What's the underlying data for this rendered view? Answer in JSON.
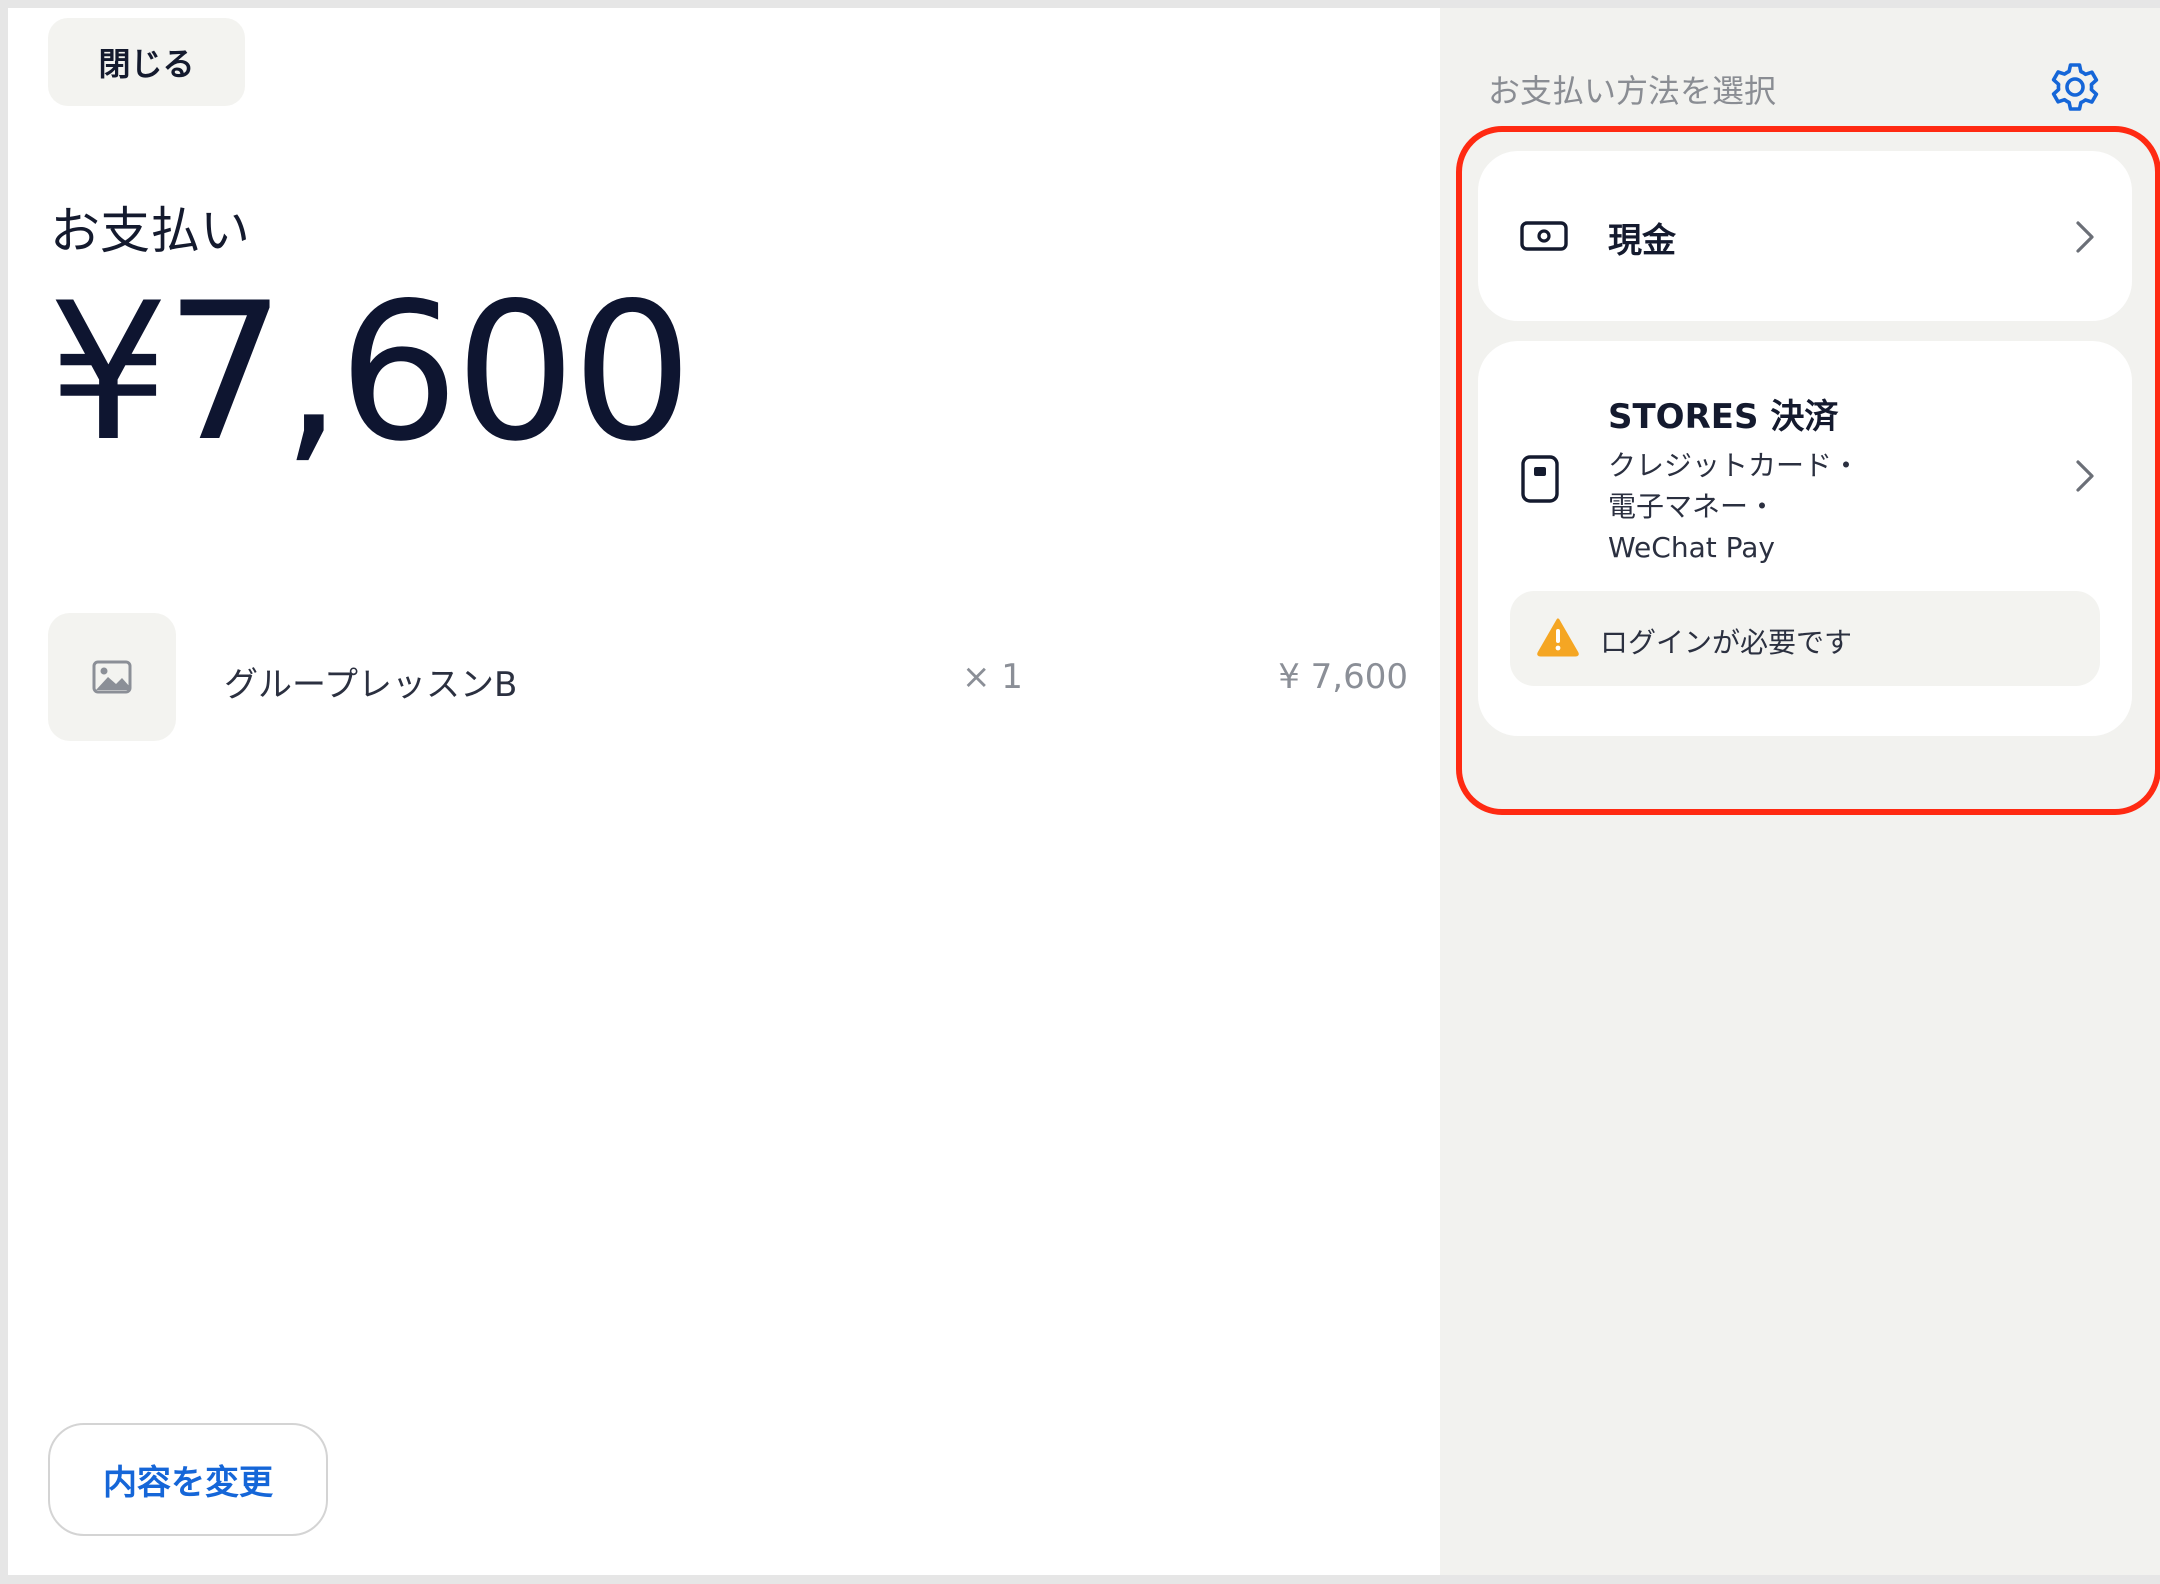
{
  "left": {
    "close_label": "閉じる",
    "title": "お支払い",
    "amount": "¥7,600",
    "item": {
      "name": "グループレッスンB",
      "quantity": "× 1",
      "price": "¥ 7,600"
    },
    "change_label": "内容を変更"
  },
  "right": {
    "title": "お支払い方法を選択",
    "methods": [
      {
        "label": "現金",
        "icon": "cash-icon"
      },
      {
        "label": "STORES 決済",
        "icon": "card-reader-icon",
        "sub1": "クレジットカード・",
        "sub2": "電子マネー・",
        "sub3": "WeChat Pay"
      }
    ],
    "login_warning": "ログインが必要です"
  },
  "colors": {
    "accent": "#1566d8",
    "highlight": "#ff2a12",
    "warning": "#f5a623",
    "panel_bg": "#f2f2ef"
  }
}
